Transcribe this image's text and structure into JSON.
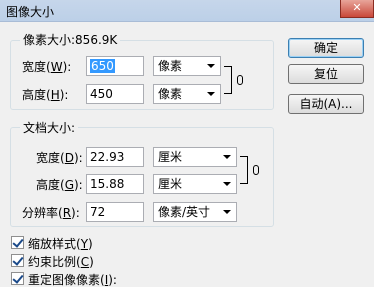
{
  "window": {
    "title": "图像大小",
    "close_label": "✕"
  },
  "pixel_dimensions": {
    "legend": "像素大小:856.9K",
    "width": {
      "label_pre": "宽度(",
      "key": "W",
      "label_post": "):",
      "value": "650",
      "unit": "像素"
    },
    "height": {
      "label_pre": "高度(",
      "key": "H",
      "label_post": "):",
      "value": "450",
      "unit": "像素"
    }
  },
  "document_size": {
    "legend": "文档大小:",
    "width": {
      "label_pre": "宽度(",
      "key": "D",
      "label_post": "):",
      "value": "22.93",
      "unit": "厘米"
    },
    "height": {
      "label_pre": "高度(",
      "key": "G",
      "label_post": "):",
      "value": "15.88",
      "unit": "厘米"
    },
    "resolution": {
      "label_pre": "分辨率(",
      "key": "R",
      "label_post": "):",
      "value": "72",
      "unit": "像素/英寸"
    }
  },
  "buttons": {
    "ok": "确定",
    "reset": "复位",
    "auto": "自动(A)..."
  },
  "options": [
    {
      "label_pre": "缩放样式(",
      "key": "Y",
      "label_post": ")",
      "checked": true
    },
    {
      "label_pre": "约束比例(",
      "key": "C",
      "label_post": ")",
      "checked": true
    },
    {
      "label_pre": "重定图像像素(",
      "key": "I",
      "label_post": "):",
      "checked": true
    }
  ]
}
